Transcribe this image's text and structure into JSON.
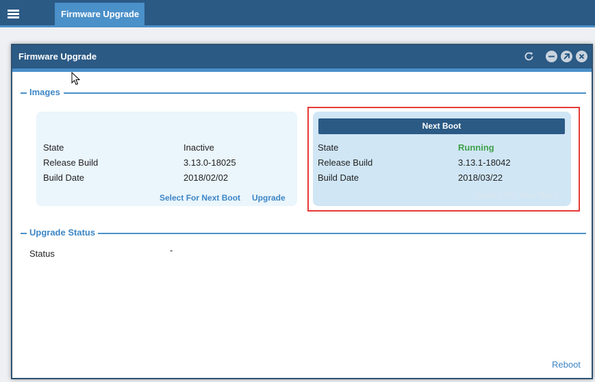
{
  "nav": {
    "tab_label": "Firmware Upgrade"
  },
  "window": {
    "title": "Firmware Upgrade"
  },
  "images": {
    "section_label": "Images",
    "current": {
      "rows": [
        {
          "label": "State",
          "value": "Inactive"
        },
        {
          "label": "Release Build",
          "value": "3.13.0-18025"
        },
        {
          "label": "Build Date",
          "value": "2018/02/02"
        }
      ],
      "select_label": "Select For Next Boot",
      "upgrade_label": "Upgrade"
    },
    "next": {
      "header": "Next Boot",
      "rows": [
        {
          "label": "State",
          "value": "Running"
        },
        {
          "label": "Release Build",
          "value": "3.13.1-18042"
        },
        {
          "label": "Build Date",
          "value": "2018/03/22"
        }
      ],
      "select_label": "Select For Next Boot"
    }
  },
  "upgrade_status": {
    "section_label": "Upgrade Status",
    "status_label": "Status",
    "status_value": "-"
  },
  "footer": {
    "reboot_label": "Reboot"
  },
  "colors": {
    "accent": "#4a90c9",
    "header": "#2b5a85",
    "running": "#3fa14a",
    "highlight": "#e53935"
  }
}
